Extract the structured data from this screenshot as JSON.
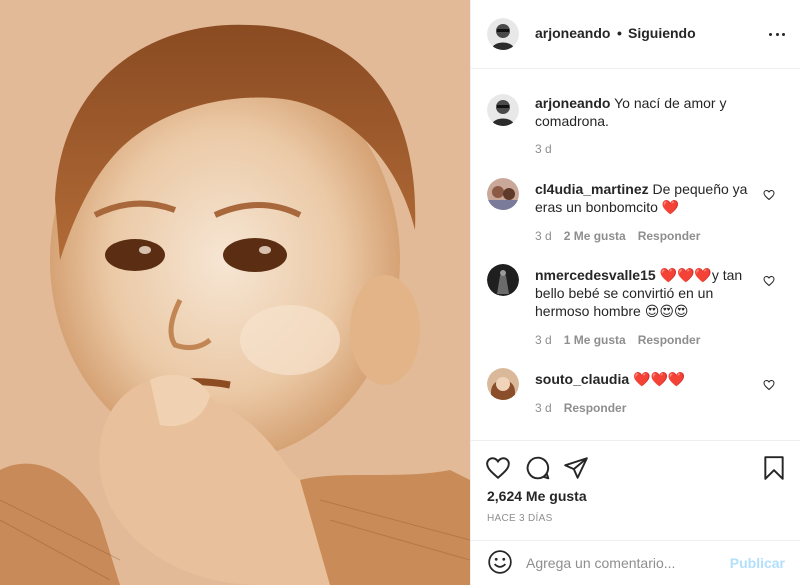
{
  "post": {
    "image_alt": "vintage sepia baby photo",
    "author": "arjoneando",
    "follow_status": "Siguiendo",
    "separator": "•"
  },
  "caption": {
    "user": "arjoneando",
    "text": "Yo nací de amor y comadrona.",
    "time": "3 d"
  },
  "comments": [
    {
      "user": "cl4udia_martinez",
      "text": "De pequeño ya eras un bonbomcito",
      "emoji": "❤️",
      "time": "3 d",
      "likes": "2 Me gusta",
      "reply": "Responder"
    },
    {
      "user": "nmercedesvalle15",
      "emoji_prefix": "❤️❤️❤️",
      "text": "y tan bello bebé se convirtió en un hermoso hombre",
      "emoji": "😍😍😍",
      "time": "3 d",
      "likes": "1 Me gusta",
      "reply": "Responder"
    },
    {
      "user": "souto_claudia",
      "emoji": "❤️❤️❤️",
      "time": "3 d",
      "reply": "Responder"
    }
  ],
  "actions": {
    "likes_count": "2,624 Me gusta",
    "time_ago": "HACE 3 DÍAS"
  },
  "add_comment": {
    "placeholder": "Agrega un comentario...",
    "post_label": "Publicar"
  },
  "icons": {
    "like": "heart-icon",
    "comment": "comment-icon",
    "share": "send-icon",
    "save": "bookmark-icon",
    "more": "more-options-icon",
    "emoji": "emoji-icon"
  },
  "colors": {
    "text": "#262626",
    "muted": "#8e8e8e",
    "heart": "#ed4956",
    "publish_disabled": "#b2dffc",
    "divider": "#efefef"
  }
}
